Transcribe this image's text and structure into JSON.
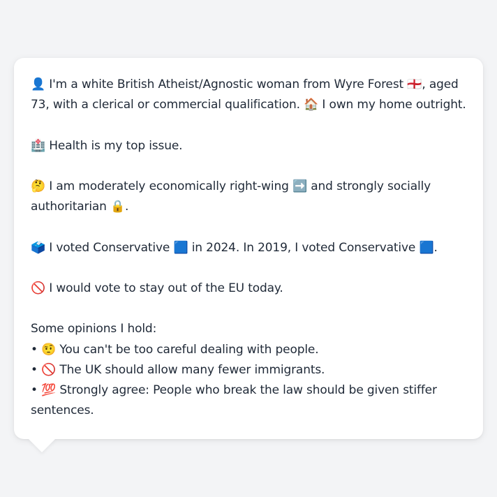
{
  "bio": {
    "p1_a": "👤 I'm a white British Atheist/Agnostic woman from Wyre Forest 🏴󠁧󠁢󠁥󠁮󠁧󠁿, aged",
    "p1_b": "73, with a clerical or commercial qualification. 🏠 I own my home outright.",
    "p2": "🏥 Health is my top issue.",
    "p3_a": "🤔 I am moderately economically right-wing ➡️ and strongly socially",
    "p3_b": "authoritarian 🔒.",
    "p4": "🗳️ I voted Conservative 🟦 in 2024. In 2019, I voted Conservative 🟦.",
    "p5": "🚫 I would vote to stay out of the EU today.",
    "opinions_heading": "Some opinions I hold:",
    "opinions": [
      "• 🤨 You can't be too careful dealing with people.",
      "• 🚫 The UK should allow many fewer immigrants.",
      "• 💯 Strongly agree: People who break the law should be given stiffer",
      "sentences."
    ]
  }
}
